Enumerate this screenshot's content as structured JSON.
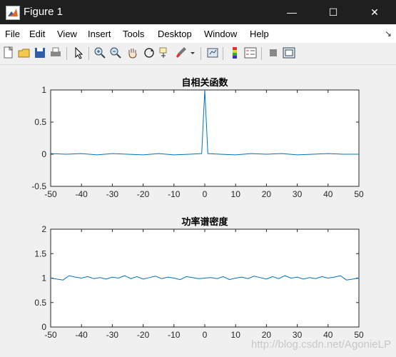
{
  "window": {
    "title": "Figure 1",
    "minimize_glyph": "—",
    "maximize_glyph": "☐",
    "close_glyph": "✕"
  },
  "menu": {
    "items": [
      "File",
      "Edit",
      "View",
      "Insert",
      "Tools",
      "Desktop",
      "Window",
      "Help"
    ],
    "expand_glyph": "↘"
  },
  "toolbar": {
    "icons": [
      "new-figure-icon",
      "open-file-icon",
      "save-icon",
      "print-icon",
      "edit-plot-arrow-icon",
      "zoom-in-icon",
      "zoom-out-icon",
      "pan-hand-icon",
      "rotate-3d-icon",
      "data-cursor-icon",
      "brush-icon",
      "brush-dropdown-icon",
      "link-plot-icon",
      "insert-colorbar-icon",
      "insert-legend-icon",
      "hide-plot-tools-icon",
      "show-plot-tools-icon"
    ]
  },
  "watermark": "http://blog.csdn.net/AgonieLP",
  "colors": {
    "line": "#0072bd",
    "titlebar": "#1f1f1f",
    "axes_bg": "#ffffff"
  },
  "chart_data": [
    {
      "type": "line",
      "title": "自相关函数",
      "xlim": [
        -50,
        50
      ],
      "ylim": [
        -0.5,
        1
      ],
      "xticks": [
        -50,
        -40,
        -30,
        -20,
        -10,
        0,
        10,
        20,
        30,
        40,
        50
      ],
      "yticks": [
        -0.5,
        0,
        0.5,
        1
      ],
      "x": [
        -50,
        -45,
        -40,
        -35,
        -30,
        -25,
        -20,
        -15,
        -10,
        -5,
        -1,
        0,
        1,
        5,
        10,
        15,
        20,
        25,
        30,
        35,
        40,
        45,
        50
      ],
      "y": [
        0.01,
        0.0,
        0.01,
        -0.01,
        0.01,
        0.0,
        -0.01,
        0.01,
        -0.01,
        0.0,
        0.01,
        1.0,
        0.01,
        0.0,
        -0.01,
        0.01,
        0.0,
        0.01,
        -0.01,
        0.0,
        0.01,
        0.0,
        0.0
      ]
    },
    {
      "type": "line",
      "title": "功率谱密度",
      "xlim": [
        -50,
        50
      ],
      "ylim": [
        0,
        2
      ],
      "xticks": [
        -50,
        -40,
        -30,
        -20,
        -10,
        0,
        10,
        20,
        30,
        40,
        50
      ],
      "yticks": [
        0,
        0.5,
        1,
        1.5,
        2
      ],
      "x": [
        -50,
        -48,
        -46,
        -44,
        -42,
        -40,
        -38,
        -36,
        -34,
        -32,
        -30,
        -28,
        -26,
        -24,
        -22,
        -20,
        -18,
        -16,
        -14,
        -12,
        -10,
        -8,
        -6,
        -4,
        -2,
        0,
        2,
        4,
        6,
        8,
        10,
        12,
        14,
        16,
        18,
        20,
        22,
        24,
        26,
        28,
        30,
        32,
        34,
        36,
        38,
        40,
        42,
        44,
        46,
        48,
        50
      ],
      "y": [
        1.0,
        0.98,
        0.96,
        1.05,
        1.02,
        1.0,
        1.03,
        0.99,
        1.01,
        0.98,
        1.02,
        1.0,
        1.05,
        0.99,
        1.03,
        0.98,
        1.01,
        1.04,
        0.99,
        1.02,
        1.0,
        0.97,
        1.03,
        1.01,
        0.99,
        1.0,
        1.01,
        0.99,
        1.03,
        0.97,
        1.0,
        1.02,
        0.99,
        1.04,
        1.01,
        0.98,
        1.03,
        0.99,
        1.05,
        1.0,
        1.02,
        0.98,
        1.01,
        0.99,
        1.03,
        1.0,
        1.02,
        1.05,
        0.96,
        0.98,
        1.0
      ]
    }
  ]
}
